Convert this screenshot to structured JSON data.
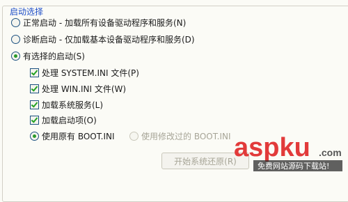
{
  "group": {
    "title": "启动选择"
  },
  "options": {
    "normal": "正常启动 - 加载所有设备驱动程序和服务(N)",
    "diagnostic": "诊断启动 - 仅加载基本设备驱动程序和服务(D)",
    "selective": "有选择的启动(S)"
  },
  "items": {
    "system_ini": "处理 SYSTEM.INI 文件(P)",
    "win_ini": "处理 WIN.INI 文件(W)",
    "services": "加载系统服务(L)",
    "startup": "加载启动项(O)"
  },
  "boot": {
    "original": "使用原有 BOOT.INI",
    "modified": "使用修改过的 BOOT.INI"
  },
  "button": {
    "restore": "开始系统还原(R)"
  },
  "watermark": {
    "brand": "aspku",
    "domain": ".com",
    "caption": "免费网站源码下载站!"
  },
  "colors": {
    "accent": "#1f4fc8",
    "brand": "#e23a3a",
    "check": "#21a121"
  }
}
